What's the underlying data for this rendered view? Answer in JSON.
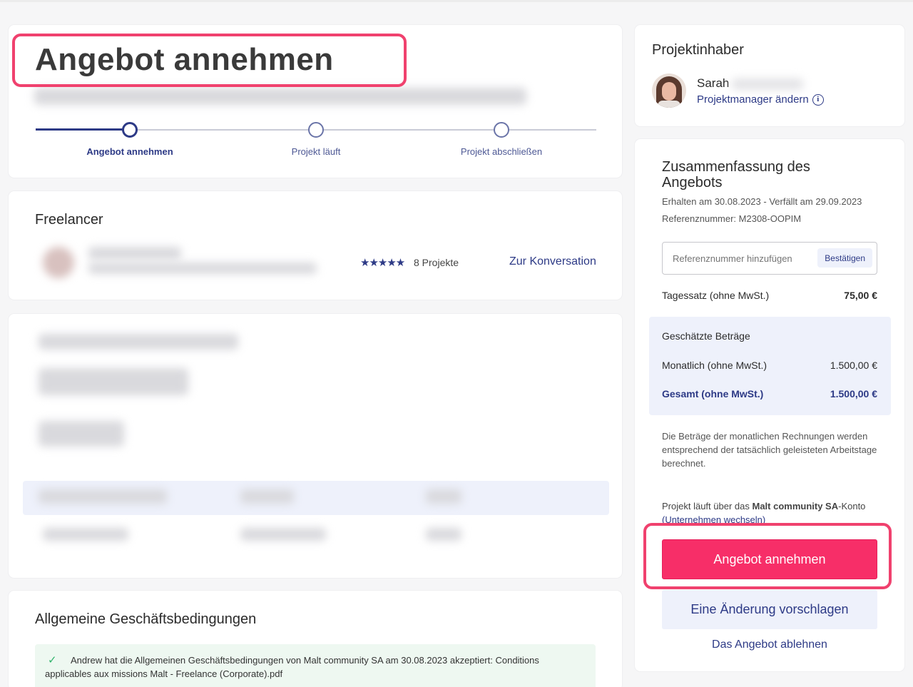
{
  "accept_header": {
    "title": "Angebot annehmen",
    "steps": [
      {
        "label": "Angebot annehmen"
      },
      {
        "label": "Projekt läuft"
      },
      {
        "label": "Projekt abschließen"
      }
    ]
  },
  "freelancer": {
    "heading": "Freelancer",
    "stars": "★★★★★",
    "projects": "8 Projekte",
    "conversation_link": "Zur Konversation"
  },
  "terms": {
    "heading": "Allgemeine Geschäftsbedingungen",
    "accepted_text": "Andrew hat die Allgemeinen Geschäftsbedingungen von Malt community SA am 30.08.2023 akzeptiert: Conditions applicables aux missions Malt - Freelance (Corporate).pdf"
  },
  "owner": {
    "heading": "Projektinhaber",
    "name": "Sarah",
    "change_manager": "Projektmanager ändern"
  },
  "summary": {
    "heading": "Zusammenfassung des Angebots",
    "received": "Erhalten am 30.08.2023 - Verfällt am 29.09.2023",
    "reference": "Referenznummer: M2308-OOPIM",
    "ref_placeholder": "Referenznummer hinzufügen",
    "confirm_label": "Bestätigen",
    "day_rate_label": "Tagessatz (ohne MwSt.)",
    "day_rate_value": "75,00 €",
    "estimates_heading": "Geschätzte Beträge",
    "monthly_label": "Monatlich (ohne MwSt.)",
    "monthly_value": "1.500,00 €",
    "total_label": "Gesamt (ohne MwSt.)",
    "total_value": "1.500,00 €",
    "note": "Die Beträge der monatlichen Rechnungen werden entsprechend der tatsächlich geleisteten Arbeitstage berechnet.",
    "account_prefix": "Projekt läuft über das",
    "account_name": "Malt community SA",
    "account_suffix": "-Konto",
    "switch_company": "(Unternehmen wechseln)",
    "accept_button": "Angebot annehmen",
    "suggest_button": "Eine Änderung vorschlagen",
    "decline_link": "Das Angebot ablehnen"
  },
  "colors": {
    "accent": "#f72e68",
    "highlight": "#f0416e",
    "primary": "#2d3a86",
    "success_bg": "#eef8f1",
    "success_icon": "#2fb36b",
    "estimates_bg": "#eef1fb"
  }
}
